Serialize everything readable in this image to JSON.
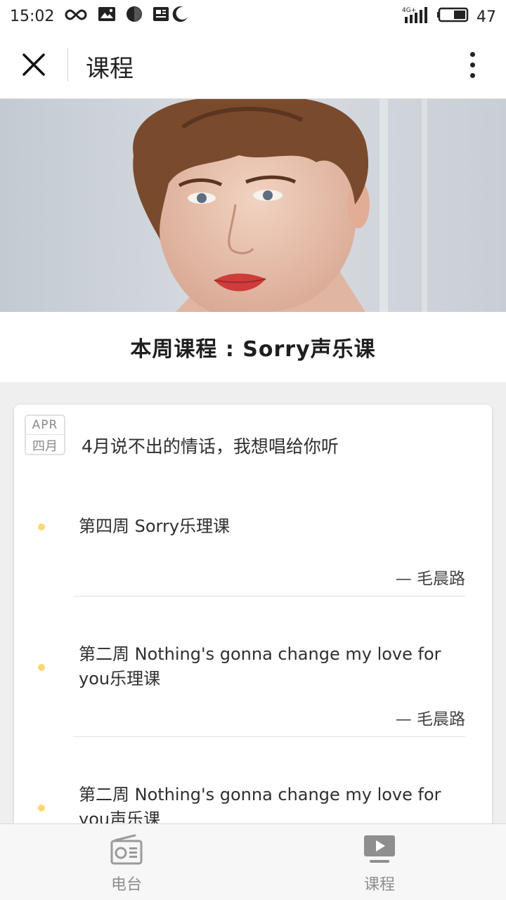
{
  "status_bar": {
    "time": "15:02",
    "network": "4G+",
    "battery": "47",
    "icons": [
      "infinity-icon",
      "image-icon",
      "circle-icon",
      "news-icon",
      "moon-icon",
      "signal-icon",
      "battery-icon"
    ]
  },
  "nav": {
    "title": "课程",
    "close_icon": "close-icon",
    "more_icon": "more-icon"
  },
  "hero": {
    "description": "portrait-photo"
  },
  "page_title": "本周课程 : Sorry声乐课",
  "card": {
    "date_month_en": "APR",
    "date_month_cn": "四月",
    "heading": "4月说不出的情话，我想唱给你听",
    "lessons": [
      {
        "title": "第四周 Sorry乐理课",
        "author": "— 毛晨路"
      },
      {
        "title": "第二周 Nothing's gonna change my love for you乐理课",
        "author": "— 毛晨路"
      },
      {
        "title": "第二周 Nothing's gonna change my love for you声乐课",
        "author": ""
      }
    ]
  },
  "tabs": [
    {
      "label": "电台",
      "icon": "radio-icon"
    },
    {
      "label": "课程",
      "icon": "play-icon"
    }
  ],
  "colors": {
    "accent_dot": "#fbd877",
    "tab_icon": "#8e8e8e"
  }
}
